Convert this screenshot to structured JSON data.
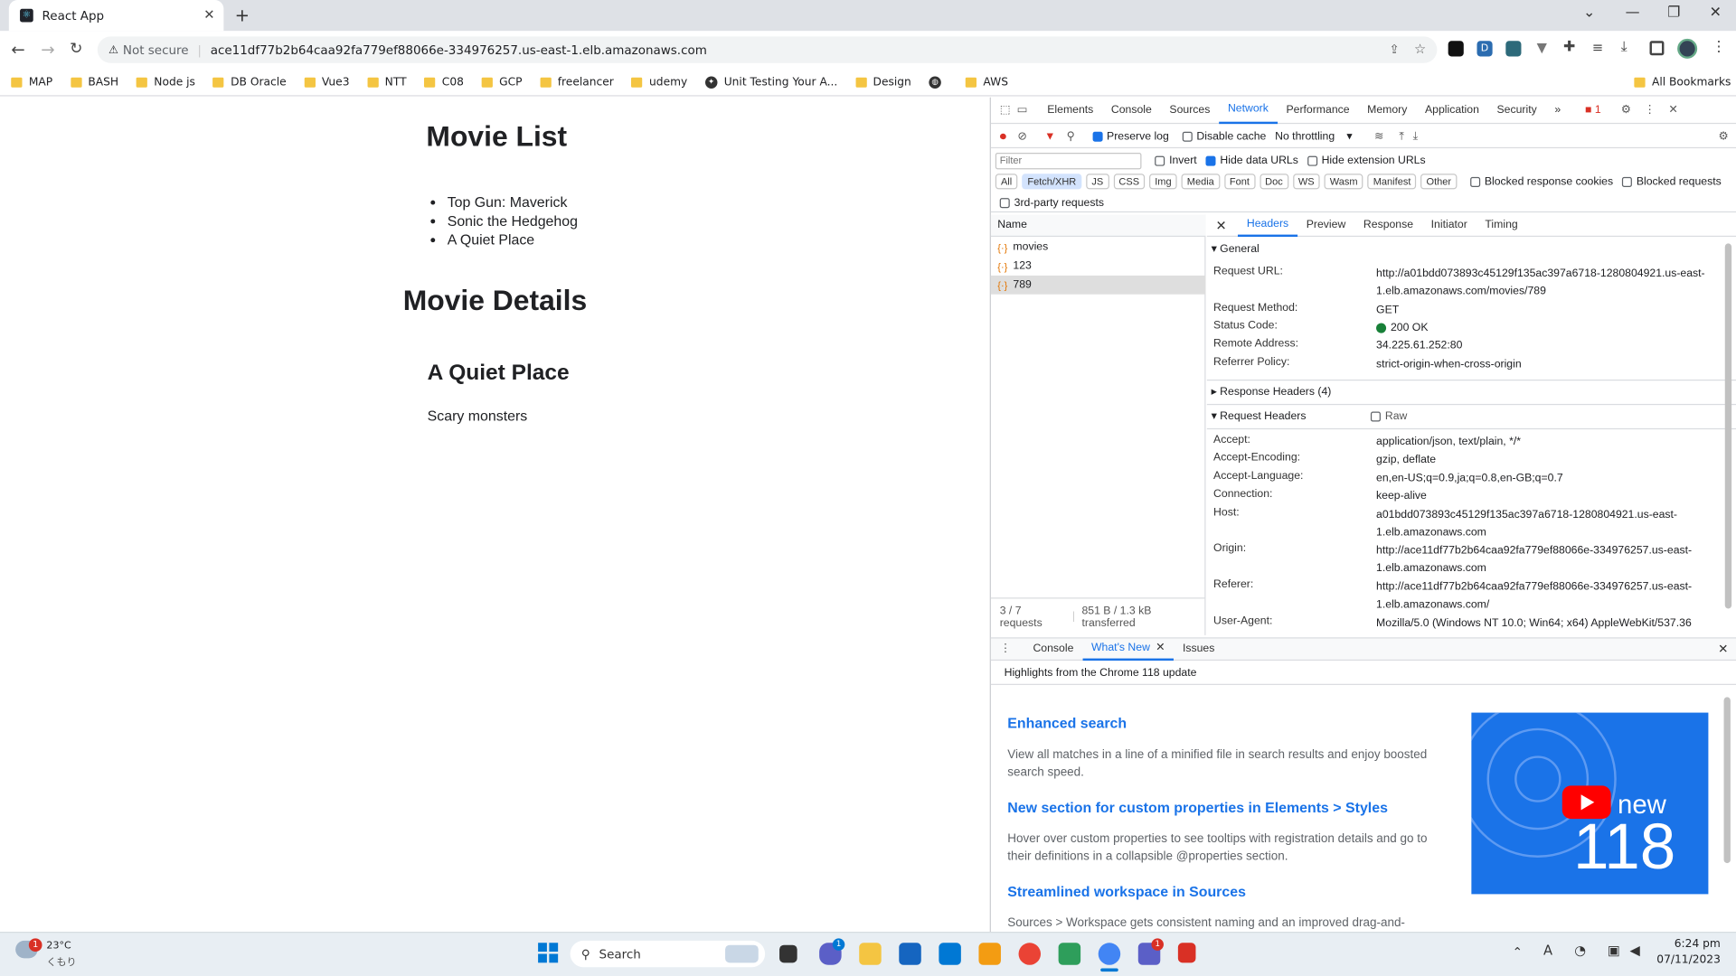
{
  "browser": {
    "tab_title": "React App",
    "omnibox_security": "Not secure",
    "url": "ace11df77b2b64caa92fa779ef88066e-334976257.us-east-1.elb.amazonaws.com",
    "bookmarks": [
      "MAP",
      "BASH",
      "Node js",
      "DB Oracle",
      "Vue3",
      "NTT",
      "C08",
      "GCP",
      "freelancer",
      "udemy",
      "Unit Testing Your A...",
      "Design",
      "AWS"
    ],
    "all_bookmarks": "All Bookmarks"
  },
  "page": {
    "list_heading": "Movie List",
    "movies": [
      "Top Gun: Maverick",
      "Sonic the Hedgehog",
      "A Quiet Place"
    ],
    "details_heading": "Movie Details",
    "selected_title": "A Quiet Place",
    "selected_description": "Scary monsters"
  },
  "devtools": {
    "tabs": [
      "Elements",
      "Console",
      "Sources",
      "Network",
      "Performance",
      "Memory",
      "Application",
      "Security"
    ],
    "error_count": "1",
    "toolbar": {
      "preserve_log": "Preserve log",
      "disable_cache": "Disable cache",
      "throttling": "No throttling"
    },
    "filter_placeholder": "Filter",
    "invert": "Invert",
    "hide_data_urls": "Hide data URLs",
    "hide_extension_urls": "Hide extension URLs",
    "type_filters": [
      "All",
      "Fetch/XHR",
      "JS",
      "CSS",
      "Img",
      "Media",
      "Font",
      "Doc",
      "WS",
      "Wasm",
      "Manifest",
      "Other"
    ],
    "blocked_response_cookies": "Blocked response cookies",
    "blocked_requests": "Blocked requests",
    "third_party": "3rd-party requests",
    "name_header": "Name",
    "requests": [
      "movies",
      "123",
      "789"
    ],
    "summary_requests": "3 / 7 requests",
    "summary_transfer": "851 B / 1.3 kB transferred",
    "detail_tabs": [
      "Headers",
      "Preview",
      "Response",
      "Initiator",
      "Timing"
    ],
    "general_label": "General",
    "general": [
      {
        "k": "Request URL:",
        "v": "http://a01bdd073893c45129f135ac397a6718-1280804921.us-east-1.elb.amazonaws.com/movies/789"
      },
      {
        "k": "Request Method:",
        "v": "GET"
      },
      {
        "k": "Status Code:",
        "v": "200 OK"
      },
      {
        "k": "Remote Address:",
        "v": "34.225.61.252:80"
      },
      {
        "k": "Referrer Policy:",
        "v": "strict-origin-when-cross-origin"
      }
    ],
    "response_headers_label": "Response Headers (4)",
    "request_headers_label": "Request Headers",
    "raw_label": "Raw",
    "request_headers": [
      {
        "k": "Accept:",
        "v": "application/json, text/plain, */*"
      },
      {
        "k": "Accept-Encoding:",
        "v": "gzip, deflate"
      },
      {
        "k": "Accept-Language:",
        "v": "en,en-US;q=0.9,ja;q=0.8,en-GB;q=0.7"
      },
      {
        "k": "Connection:",
        "v": "keep-alive"
      },
      {
        "k": "Host:",
        "v": "a01bdd073893c45129f135ac397a6718-1280804921.us-east-1.elb.amazonaws.com"
      },
      {
        "k": "Origin:",
        "v": "http://ace11df77b2b64caa92fa779ef88066e-334976257.us-east-1.elb.amazonaws.com"
      },
      {
        "k": "Referer:",
        "v": "http://ace11df77b2b64caa92fa779ef88066e-334976257.us-east-1.elb.amazonaws.com/"
      },
      {
        "k": "User-Agent:",
        "v": "Mozilla/5.0 (Windows NT 10.0; Win64; x64) AppleWebKit/537.36"
      }
    ],
    "drawer_tabs": [
      "Console",
      "What's New",
      "Issues"
    ],
    "whats_new_intro": "Highlights from the Chrome 118 update",
    "whats_new": [
      {
        "title": "Enhanced search",
        "body": "View all matches in a line of a minified file in search results and enjoy boosted search speed."
      },
      {
        "title": "New section for custom properties in Elements > Styles",
        "body": "Hover over custom properties to see tooltips with registration details and go to their definitions in a collapsible @properties section."
      },
      {
        "title": "Streamlined workspace in Sources",
        "body": "Sources > Workspace gets consistent naming and an improved drag-and-"
      }
    ],
    "video_new": "new",
    "video_version": "118"
  },
  "taskbar": {
    "weather_temp": "23°C",
    "weather_desc": "くもり",
    "weather_badge": "1",
    "search": "Search",
    "time": "6:24 pm",
    "date": "07/11/2023",
    "teams_badge": "1",
    "chat_badge": "1"
  },
  "colors": {
    "accent": "#1a73e8",
    "link": "#1a73e8",
    "error": "#d93025",
    "status_ok": "#188038"
  }
}
